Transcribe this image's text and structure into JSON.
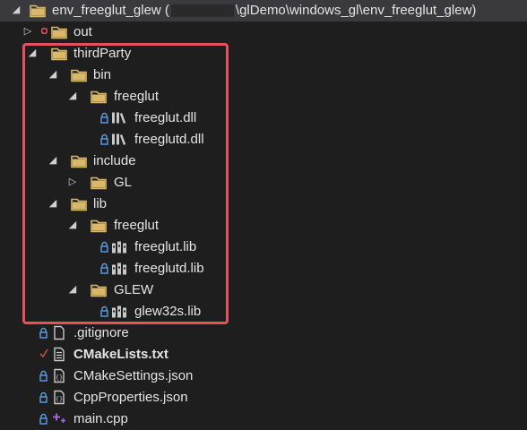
{
  "root": {
    "label_start": "env_freeglut_glew (",
    "label_end": "\\glDemo\\windows_gl\\env_freeglut_glew)"
  },
  "items": {
    "out": "out",
    "thirdParty": "thirdParty",
    "bin": "bin",
    "bin_freeglut": "freeglut",
    "freeglut_dll": "freeglut.dll",
    "freeglutd_dll": "freeglutd.dll",
    "include": "include",
    "gl": "GL",
    "lib": "lib",
    "lib_freeglut": "freeglut",
    "freeglut_lib": "freeglut.lib",
    "freeglutd_lib": "freeglutd.lib",
    "glew": "GLEW",
    "glew32s_lib": "glew32s.lib",
    "gitignore": ".gitignore",
    "cmakelists": "CMakeLists.txt",
    "cmakesettings": "CMakeSettings.json",
    "cppproperties": "CppProperties.json",
    "maincpp": "main.cpp"
  },
  "colors": {
    "background": "#1e1e1e",
    "folder": "#d9b86a",
    "highlight_border": "#e8505f",
    "lock": "#5aa0e6",
    "check": "#c84b4b",
    "cpp": "#a96be0"
  },
  "icons": {
    "folder": "folder-icon",
    "dll": "dll-icon",
    "lib": "lib-icon",
    "file": "file-icon",
    "text": "text-file-icon",
    "json": "json-file-icon",
    "cpp": "cpp-file-icon",
    "lock": "lock-icon",
    "check": "checkmark-icon"
  }
}
